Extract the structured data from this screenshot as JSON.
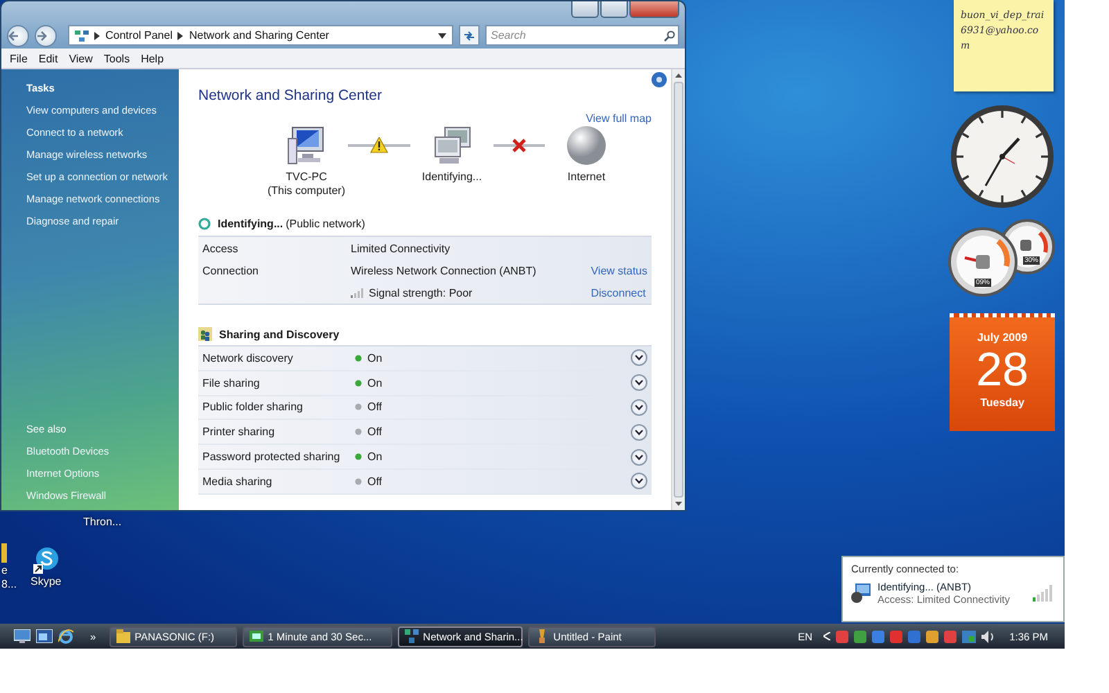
{
  "window": {
    "breadcrumb": [
      "Control Panel",
      "Network and Sharing Center"
    ],
    "search": {
      "placeholder": "Search"
    },
    "menu": [
      "File",
      "Edit",
      "View",
      "Tools",
      "Help"
    ],
    "sidebar": {
      "tasks_title": "Tasks",
      "tasks": [
        "View computers and devices",
        "Connect to a network",
        "Manage wireless networks",
        "Set up a connection or network",
        "Manage network connections",
        "Diagnose and repair"
      ],
      "see_also_title": "See also",
      "see_also": [
        "Bluetooth Devices",
        "Internet Options",
        "Windows Firewall"
      ]
    },
    "title": "Network and Sharing Center",
    "view_full_map": "View full map",
    "map_nodes": [
      {
        "kind": "computer",
        "label": "TVC-PC",
        "sublabel": "(This computer)"
      },
      {
        "kind": "network",
        "label": "Identifying..."
      },
      {
        "kind": "globe",
        "label": "Internet"
      }
    ],
    "map_links": [
      {
        "kind": "warning"
      },
      {
        "kind": "error"
      }
    ],
    "network": {
      "name": "Identifying...",
      "type": "(Public network)",
      "rows": [
        {
          "kind": "text",
          "label": "Access",
          "value": "Limited Connectivity"
        },
        {
          "kind": "text",
          "label": "Connection",
          "value": "Wireless Network Connection (ANBT)",
          "action": "View status"
        },
        {
          "kind": "signal",
          "value": "Signal strength:  Poor",
          "action": "Disconnect"
        }
      ]
    },
    "sharing": {
      "title": "Sharing and Discovery",
      "items": [
        {
          "label": "Network discovery",
          "status": "On",
          "on": true
        },
        {
          "label": "File sharing",
          "status": "On",
          "on": true
        },
        {
          "label": "Public folder sharing",
          "status": "Off",
          "on": false
        },
        {
          "label": "Printer sharing",
          "status": "Off",
          "on": false
        },
        {
          "label": "Password protected sharing",
          "status": "On",
          "on": true
        },
        {
          "label": "Media sharing",
          "status": "Off",
          "on": false
        }
      ]
    }
  },
  "desktop_icons": [
    {
      "kind": "clipped",
      "lines": [
        "e",
        "8..."
      ]
    },
    {
      "kind": "plain",
      "lines": [
        "Thron..."
      ]
    },
    {
      "kind": "skype",
      "lines": [
        "Skype"
      ]
    }
  ],
  "gadgets": {
    "sticky_note": "buon_vi_dep_trai6931@yahoo.com",
    "meters": [
      "09%",
      "30%"
    ],
    "calendar": {
      "month": "July 2009",
      "day": "28",
      "weekday": "Tuesday"
    }
  },
  "popup": {
    "title": "Currently connected to:",
    "name": "Identifying... (ANBT)",
    "access": "Access:  Limited Connectivity"
  },
  "taskbar": {
    "more": "»",
    "tasks": [
      {
        "label": "PANASONIC (F:)",
        "selected": false,
        "kind": "folder"
      },
      {
        "label": "1 Minute and 30 Sec...",
        "selected": false,
        "kind": "media"
      },
      {
        "label": "Network and Sharin...",
        "selected": true,
        "kind": "network"
      },
      {
        "label": "Untitled - Paint",
        "selected": false,
        "kind": "paint"
      }
    ],
    "language": "EN",
    "time": "1:36 PM"
  }
}
